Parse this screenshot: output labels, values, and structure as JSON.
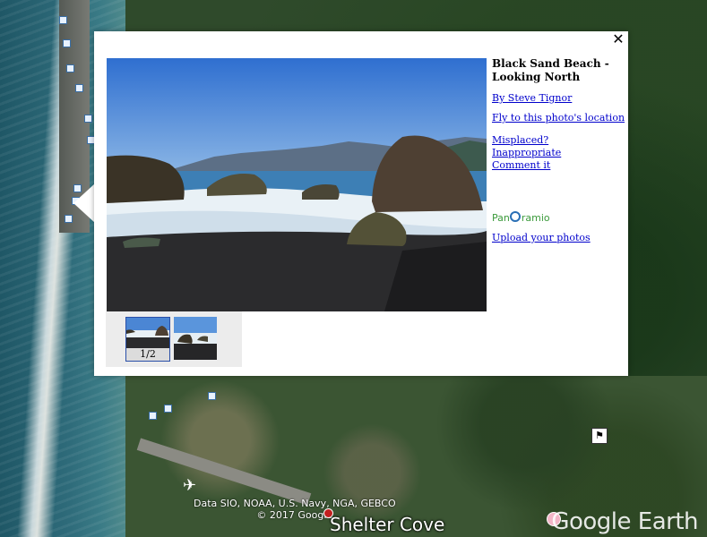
{
  "map": {
    "logo": "Google Earth",
    "attribution_line1": "Data SIO, NOAA, U.S. Navy, NGA, GEBCO",
    "attribution_line2": "© 2017 Google",
    "place_label": "Shelter Cove",
    "icons": [
      "photo-pin-icon",
      "airport-icon",
      "flag-icon",
      "place-marker-icon"
    ]
  },
  "popup": {
    "close_label": "✕",
    "title": "Black Sand Beach - Looking North",
    "author_link": "By Steve Tignor",
    "fly_link": "Fly to this photo's location",
    "misplaced_link": "Misplaced?",
    "inappropriate_link": "Inappropriate",
    "comment_link": "Comment it",
    "brand_prefix": "Pan",
    "brand_suffix": "ramio",
    "upload_link": "Upload your photos",
    "thumb_counter": "1/2",
    "colors": {
      "link": "#0000cc",
      "brand_green": "#3b9a3b",
      "brand_blue": "#2a6fb5"
    }
  }
}
